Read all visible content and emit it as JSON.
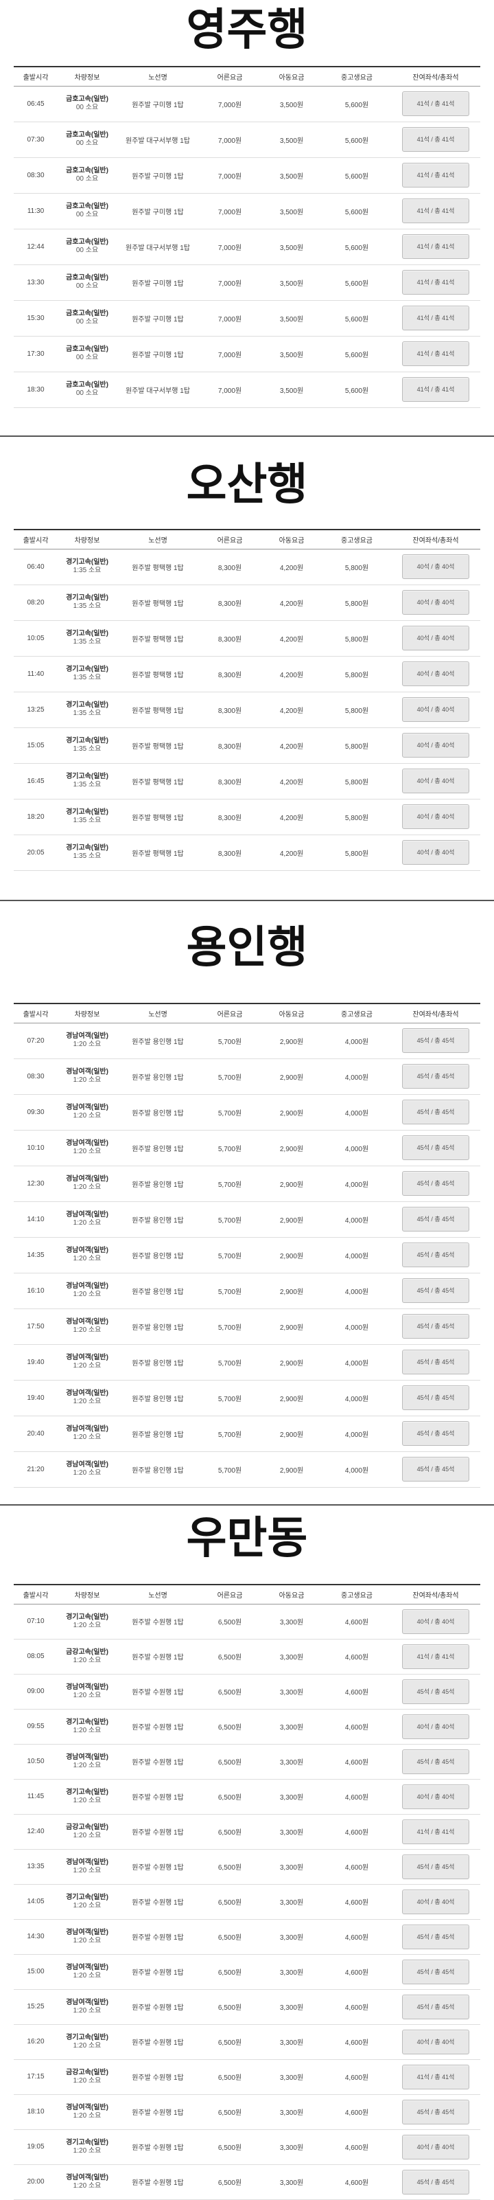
{
  "columns": [
    "출발시각",
    "차량정보",
    "노선명",
    "어른요금",
    "아동요금",
    "중고생요금",
    "잔여좌석/총좌석"
  ],
  "sections": [
    {
      "title": "영주행",
      "rows": [
        {
          "time": "06:45",
          "company": "금호고속(일반)",
          "duration": "00 소요",
          "route": "원주발 구미행 1탑",
          "adult": "7,000원",
          "child": "3,500원",
          "youth": "5,600원",
          "seats": "41석 / 총 41석"
        },
        {
          "time": "07:30",
          "company": "금호고속(일반)",
          "duration": "00 소요",
          "route": "원주발 대구서부행 1탑",
          "adult": "7,000원",
          "child": "3,500원",
          "youth": "5,600원",
          "seats": "41석 / 총 41석"
        },
        {
          "time": "08:30",
          "company": "금호고속(일반)",
          "duration": "00 소요",
          "route": "원주발 구미행 1탑",
          "adult": "7,000원",
          "child": "3,500원",
          "youth": "5,600원",
          "seats": "41석 / 총 41석"
        },
        {
          "time": "11:30",
          "company": "금호고속(일반)",
          "duration": "00 소요",
          "route": "원주발 구미행 1탑",
          "adult": "7,000원",
          "child": "3,500원",
          "youth": "5,600원",
          "seats": "41석 / 총 41석"
        },
        {
          "time": "12:44",
          "company": "금호고속(일반)",
          "duration": "00 소요",
          "route": "원주발 대구서부행 1탑",
          "adult": "7,000원",
          "child": "3,500원",
          "youth": "5,600원",
          "seats": "41석 / 총 41석"
        },
        {
          "time": "13:30",
          "company": "금호고속(일반)",
          "duration": "00 소요",
          "route": "원주발 구미행 1탑",
          "adult": "7,000원",
          "child": "3,500원",
          "youth": "5,600원",
          "seats": "41석 / 총 41석"
        },
        {
          "time": "15:30",
          "company": "금호고속(일반)",
          "duration": "00 소요",
          "route": "원주발 구미행 1탑",
          "adult": "7,000원",
          "child": "3,500원",
          "youth": "5,600원",
          "seats": "41석 / 총 41석"
        },
        {
          "time": "17:30",
          "company": "금호고속(일반)",
          "duration": "00 소요",
          "route": "원주발 구미행 1탑",
          "adult": "7,000원",
          "child": "3,500원",
          "youth": "5,600원",
          "seats": "41석 / 총 41석"
        },
        {
          "time": "18:30",
          "company": "금호고속(일반)",
          "duration": "00 소요",
          "route": "원주발 대구서부행 1탑",
          "adult": "7,000원",
          "child": "3,500원",
          "youth": "5,600원",
          "seats": "41석 / 총 41석"
        }
      ]
    },
    {
      "title": "오산행",
      "rows": [
        {
          "time": "06:40",
          "company": "경기고속(일반)",
          "duration": "1:35 소요",
          "route": "원주발 평택행 1탑",
          "adult": "8,300원",
          "child": "4,200원",
          "youth": "5,800원",
          "seats": "40석 / 총 40석"
        },
        {
          "time": "08:20",
          "company": "경기고속(일반)",
          "duration": "1:35 소요",
          "route": "원주발 평택행 1탑",
          "adult": "8,300원",
          "child": "4,200원",
          "youth": "5,800원",
          "seats": "40석 / 총 40석"
        },
        {
          "time": "10:05",
          "company": "경기고속(일반)",
          "duration": "1:35 소요",
          "route": "원주발 평택행 1탑",
          "adult": "8,300원",
          "child": "4,200원",
          "youth": "5,800원",
          "seats": "40석 / 총 40석"
        },
        {
          "time": "11:40",
          "company": "경기고속(일반)",
          "duration": "1:35 소요",
          "route": "원주발 평택행 1탑",
          "adult": "8,300원",
          "child": "4,200원",
          "youth": "5,800원",
          "seats": "40석 / 총 40석"
        },
        {
          "time": "13:25",
          "company": "경기고속(일반)",
          "duration": "1:35 소요",
          "route": "원주발 평택행 1탑",
          "adult": "8,300원",
          "child": "4,200원",
          "youth": "5,800원",
          "seats": "40석 / 총 40석"
        },
        {
          "time": "15:05",
          "company": "경기고속(일반)",
          "duration": "1:35 소요",
          "route": "원주발 평택행 1탑",
          "adult": "8,300원",
          "child": "4,200원",
          "youth": "5,800원",
          "seats": "40석 / 총 40석"
        },
        {
          "time": "16:45",
          "company": "경기고속(일반)",
          "duration": "1:35 소요",
          "route": "원주발 평택행 1탑",
          "adult": "8,300원",
          "child": "4,200원",
          "youth": "5,800원",
          "seats": "40석 / 총 40석"
        },
        {
          "time": "18:20",
          "company": "경기고속(일반)",
          "duration": "1:35 소요",
          "route": "원주발 평택행 1탑",
          "adult": "8,300원",
          "child": "4,200원",
          "youth": "5,800원",
          "seats": "40석 / 총 40석"
        },
        {
          "time": "20:05",
          "company": "경기고속(일반)",
          "duration": "1:35 소요",
          "route": "원주발 평택행 1탑",
          "adult": "8,300원",
          "child": "4,200원",
          "youth": "5,800원",
          "seats": "40석 / 총 40석"
        }
      ]
    },
    {
      "title": "용인행",
      "rows": [
        {
          "time": "07:20",
          "company": "경남여객(일반)",
          "duration": "1:20 소요",
          "route": "원주발 용인행 1탑",
          "adult": "5,700원",
          "child": "2,900원",
          "youth": "4,000원",
          "seats": "45석 / 총 45석"
        },
        {
          "time": "08:30",
          "company": "경남여객(일반)",
          "duration": "1:20 소요",
          "route": "원주발 용인행 1탑",
          "adult": "5,700원",
          "child": "2,900원",
          "youth": "4,000원",
          "seats": "45석 / 총 45석"
        },
        {
          "time": "09:30",
          "company": "경남여객(일반)",
          "duration": "1:20 소요",
          "route": "원주발 용인행 1탑",
          "adult": "5,700원",
          "child": "2,900원",
          "youth": "4,000원",
          "seats": "45석 / 총 45석"
        },
        {
          "time": "10:10",
          "company": "경남여객(일반)",
          "duration": "1:20 소요",
          "route": "원주발 용인행 1탑",
          "adult": "5,700원",
          "child": "2,900원",
          "youth": "4,000원",
          "seats": "45석 / 총 45석"
        },
        {
          "time": "12:30",
          "company": "경남여객(일반)",
          "duration": "1:20 소요",
          "route": "원주발 용인행 1탑",
          "adult": "5,700원",
          "child": "2,900원",
          "youth": "4,000원",
          "seats": "45석 / 총 45석"
        },
        {
          "time": "14:10",
          "company": "경남여객(일반)",
          "duration": "1:20 소요",
          "route": "원주발 용인행 1탑",
          "adult": "5,700원",
          "child": "2,900원",
          "youth": "4,000원",
          "seats": "45석 / 총 45석"
        },
        {
          "time": "14:35",
          "company": "경남여객(일반)",
          "duration": "1:20 소요",
          "route": "원주발 용인행 1탑",
          "adult": "5,700원",
          "child": "2,900원",
          "youth": "4,000원",
          "seats": "45석 / 총 45석"
        },
        {
          "time": "16:10",
          "company": "경남여객(일반)",
          "duration": "1:20 소요",
          "route": "원주발 용인행 1탑",
          "adult": "5,700원",
          "child": "2,900원",
          "youth": "4,000원",
          "seats": "45석 / 총 45석"
        },
        {
          "time": "17:50",
          "company": "경남여객(일반)",
          "duration": "1:20 소요",
          "route": "원주발 용인행 1탑",
          "adult": "5,700원",
          "child": "2,900원",
          "youth": "4,000원",
          "seats": "45석 / 총 45석"
        },
        {
          "time": "19:40",
          "company": "경남여객(일반)",
          "duration": "1:20 소요",
          "route": "원주발 용인행 1탑",
          "adult": "5,700원",
          "child": "2,900원",
          "youth": "4,000원",
          "seats": "45석 / 총 45석"
        },
        {
          "time": "19:40",
          "company": "경남여객(일반)",
          "duration": "1:20 소요",
          "route": "원주발 용인행 1탑",
          "adult": "5,700원",
          "child": "2,900원",
          "youth": "4,000원",
          "seats": "45석 / 총 45석"
        },
        {
          "time": "20:40",
          "company": "경남여객(일반)",
          "duration": "1:20 소요",
          "route": "원주발 용인행 1탑",
          "adult": "5,700원",
          "child": "2,900원",
          "youth": "4,000원",
          "seats": "45석 / 총 45석"
        },
        {
          "time": "21:20",
          "company": "경남여객(일반)",
          "duration": "1:20 소요",
          "route": "원주발 용인행 1탑",
          "adult": "5,700원",
          "child": "2,900원",
          "youth": "4,000원",
          "seats": "45석 / 총 45석"
        }
      ]
    },
    {
      "title": "우만동",
      "rows": [
        {
          "time": "07:10",
          "company": "경기고속(일반)",
          "duration": "1:20 소요",
          "route": "원주발 수원행 1탑",
          "adult": "6,500원",
          "child": "3,300원",
          "youth": "4,600원",
          "seats": "40석 / 총 40석"
        },
        {
          "time": "08:05",
          "company": "금강고속(일반)",
          "duration": "1:20 소요",
          "route": "원주발 수원행 1탑",
          "adult": "6,500원",
          "child": "3,300원",
          "youth": "4,600원",
          "seats": "41석 / 총 41석"
        },
        {
          "time": "09:00",
          "company": "경남여객(일반)",
          "duration": "1:20 소요",
          "route": "원주발 수원행 1탑",
          "adult": "6,500원",
          "child": "3,300원",
          "youth": "4,600원",
          "seats": "45석 / 총 45석"
        },
        {
          "time": "09:55",
          "company": "경기고속(일반)",
          "duration": "1:20 소요",
          "route": "원주발 수원행 1탑",
          "adult": "6,500원",
          "child": "3,300원",
          "youth": "4,600원",
          "seats": "40석 / 총 40석"
        },
        {
          "time": "10:50",
          "company": "경남여객(일반)",
          "duration": "1:20 소요",
          "route": "원주발 수원행 1탑",
          "adult": "6,500원",
          "child": "3,300원",
          "youth": "4,600원",
          "seats": "45석 / 총 45석"
        },
        {
          "time": "11:45",
          "company": "경기고속(일반)",
          "duration": "1:20 소요",
          "route": "원주발 수원행 1탑",
          "adult": "6,500원",
          "child": "3,300원",
          "youth": "4,600원",
          "seats": "40석 / 총 40석"
        },
        {
          "time": "12:40",
          "company": "금강고속(일반)",
          "duration": "1:20 소요",
          "route": "원주발 수원행 1탑",
          "adult": "6,500원",
          "child": "3,300원",
          "youth": "4,600원",
          "seats": "41석 / 총 41석"
        },
        {
          "time": "13:35",
          "company": "경남여객(일반)",
          "duration": "1:20 소요",
          "route": "원주발 수원행 1탑",
          "adult": "6,500원",
          "child": "3,300원",
          "youth": "4,600원",
          "seats": "45석 / 총 45석"
        },
        {
          "time": "14:05",
          "company": "경기고속(일반)",
          "duration": "1:20 소요",
          "route": "원주발 수원행 1탑",
          "adult": "6,500원",
          "child": "3,300원",
          "youth": "4,600원",
          "seats": "40석 / 총 40석"
        },
        {
          "time": "14:30",
          "company": "경남여객(일반)",
          "duration": "1:20 소요",
          "route": "원주발 수원행 1탑",
          "adult": "6,500원",
          "child": "3,300원",
          "youth": "4,600원",
          "seats": "45석 / 총 45석"
        },
        {
          "time": "15:00",
          "company": "경남여객(일반)",
          "duration": "1:20 소요",
          "route": "원주발 수원행 1탑",
          "adult": "6,500원",
          "child": "3,300원",
          "youth": "4,600원",
          "seats": "45석 / 총 45석"
        },
        {
          "time": "15:25",
          "company": "경남여객(일반)",
          "duration": "1:20 소요",
          "route": "원주발 수원행 1탑",
          "adult": "6,500원",
          "child": "3,300원",
          "youth": "4,600원",
          "seats": "45석 / 총 45석"
        },
        {
          "time": "16:20",
          "company": "경기고속(일반)",
          "duration": "1:20 소요",
          "route": "원주발 수원행 1탑",
          "adult": "6,500원",
          "child": "3,300원",
          "youth": "4,600원",
          "seats": "40석 / 총 40석"
        },
        {
          "time": "17:15",
          "company": "금강고속(일반)",
          "duration": "1:20 소요",
          "route": "원주발 수원행 1탑",
          "adult": "6,500원",
          "child": "3,300원",
          "youth": "4,600원",
          "seats": "41석 / 총 41석"
        },
        {
          "time": "18:10",
          "company": "경남여객(일반)",
          "duration": "1:20 소요",
          "route": "원주발 수원행 1탑",
          "adult": "6,500원",
          "child": "3,300원",
          "youth": "4,600원",
          "seats": "45석 / 총 45석"
        },
        {
          "time": "19:05",
          "company": "경기고속(일반)",
          "duration": "1:20 소요",
          "route": "원주발 수원행 1탑",
          "adult": "6,500원",
          "child": "3,300원",
          "youth": "4,600원",
          "seats": "40석 / 총 40석"
        },
        {
          "time": "20:00",
          "company": "경남여객(일반)",
          "duration": "1:20 소요",
          "route": "원주발 수원행 1탑",
          "adult": "6,500원",
          "child": "3,300원",
          "youth": "4,600원",
          "seats": "45석 / 총 45석"
        }
      ]
    }
  ]
}
